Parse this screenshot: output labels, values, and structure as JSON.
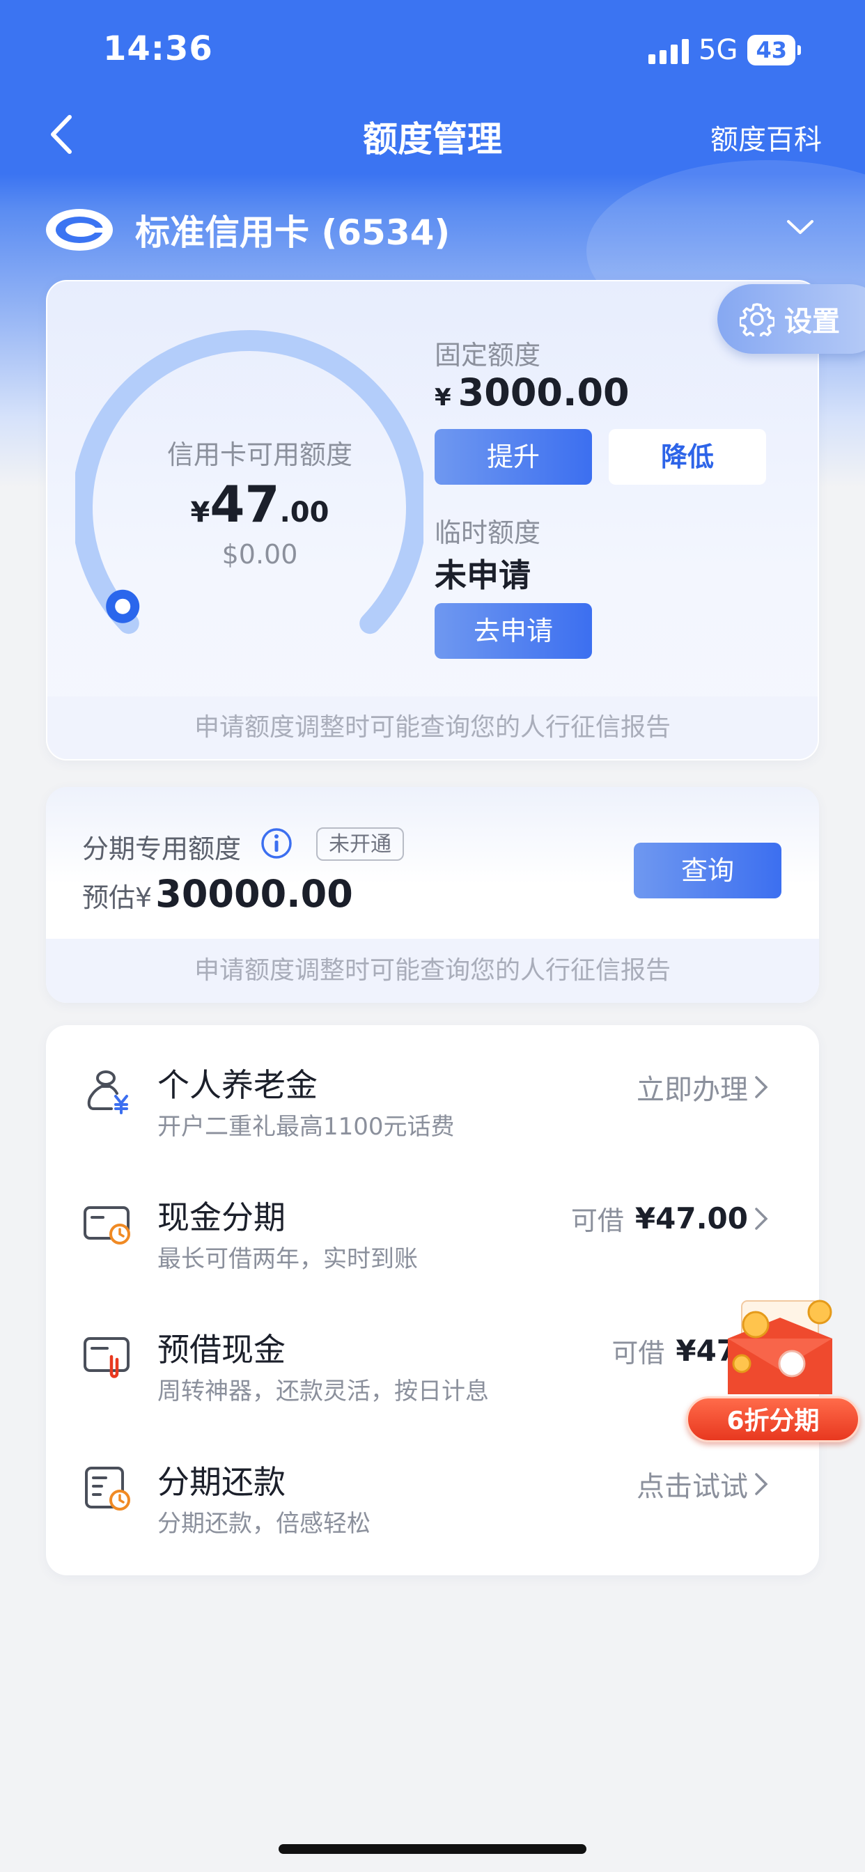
{
  "status": {
    "time": "14:36",
    "network": "5G",
    "battery": "43"
  },
  "nav": {
    "title": "额度管理",
    "right_link": "额度百科"
  },
  "card": {
    "name": "标准信用卡 (6534)"
  },
  "credit": {
    "settings_label": "设置",
    "available_label": "信用卡可用额度",
    "available_currency": "¥",
    "available_int": "47",
    "available_dec": ".00",
    "available_usd": "$0.00",
    "fixed_label": "固定额度",
    "fixed_currency": "¥",
    "fixed_value": "3000.00",
    "raise_label": "提升",
    "lower_label": "降低",
    "temp_label": "临时额度",
    "temp_value": "未申请",
    "apply_label": "去申请",
    "notice": "申请额度调整时可能查询您的人行征信报告",
    "gauge_fraction": 0.0157
  },
  "installment": {
    "label": "分期专用额度",
    "badge": "未开通",
    "estimate_prefix": "预估¥",
    "estimate_value": "30000.00",
    "query_label": "查询",
    "notice": "申请额度调整时可能查询您的人行征信报告"
  },
  "services": [
    {
      "title": "个人养老金",
      "subtitle": "开户二重礼最高1100元话费",
      "right_label": "立即办理",
      "amount": "",
      "icon": "pension-icon"
    },
    {
      "title": "现金分期",
      "subtitle": "最长可借两年，实时到账",
      "right_label": "可借",
      "amount": "¥47.00",
      "icon": "cash-installment-icon"
    },
    {
      "title": "预借现金",
      "subtitle": "周转神器，还款灵活，按日计息",
      "right_label": "可借",
      "amount": "¥47.",
      "icon": "cash-advance-icon"
    },
    {
      "title": "分期还款",
      "subtitle": "分期还款，倍感轻松",
      "right_label": "点击试试",
      "amount": "",
      "icon": "installment-repay-icon"
    }
  ],
  "promo": {
    "label": "6折分期"
  },
  "colors": {
    "brand_blue": "#3b74f2",
    "accent_red": "#e8381f"
  }
}
